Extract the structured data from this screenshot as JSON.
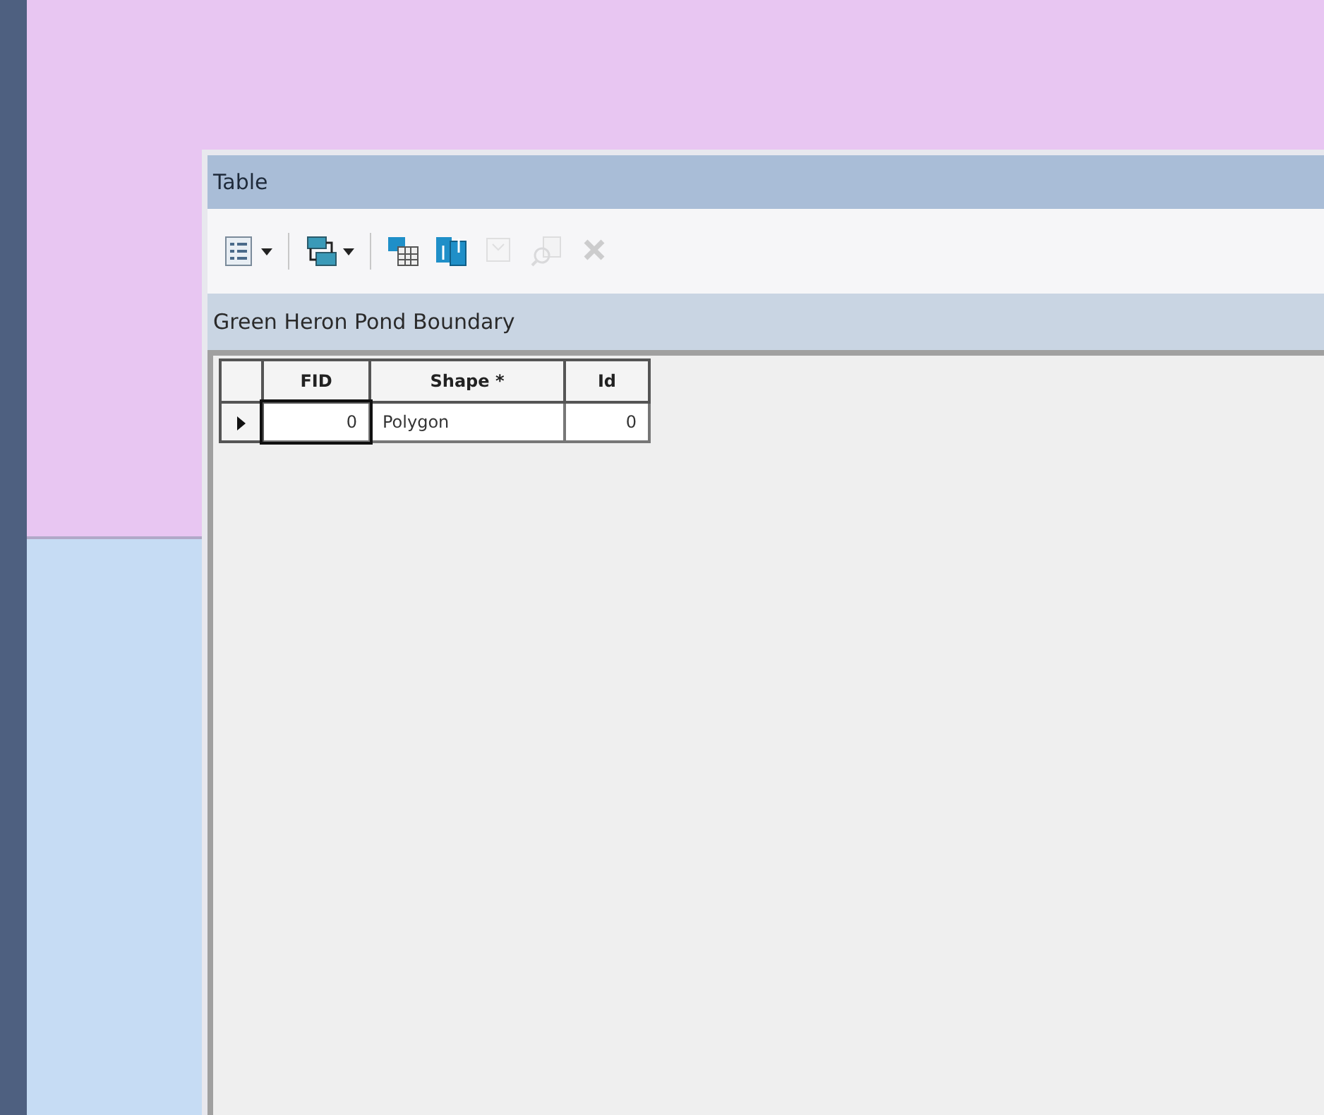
{
  "window": {
    "title": "Table"
  },
  "toolbar": [
    {
      "kind": "options",
      "dropdown": true,
      "disabled": false
    },
    {
      "kind": "relate",
      "dropdown": true,
      "disabled": false
    },
    {
      "kind": "select-by-attributes",
      "dropdown": false,
      "disabled": false
    },
    {
      "kind": "switch-selection",
      "dropdown": false,
      "disabled": false
    },
    {
      "kind": "clear-selection",
      "dropdown": false,
      "disabled": true
    },
    {
      "kind": "zoom-selected",
      "dropdown": false,
      "disabled": true
    },
    {
      "kind": "delete",
      "dropdown": false,
      "disabled": true
    }
  ],
  "layer_tab": {
    "title": "Green Heron Pond Boundary"
  },
  "table": {
    "columns": [
      {
        "label": "FID"
      },
      {
        "label": "Shape *"
      },
      {
        "label": "Id"
      }
    ],
    "rows": [
      {
        "selected": true,
        "cells": [
          "0",
          "Polygon",
          "0"
        ]
      }
    ]
  }
}
